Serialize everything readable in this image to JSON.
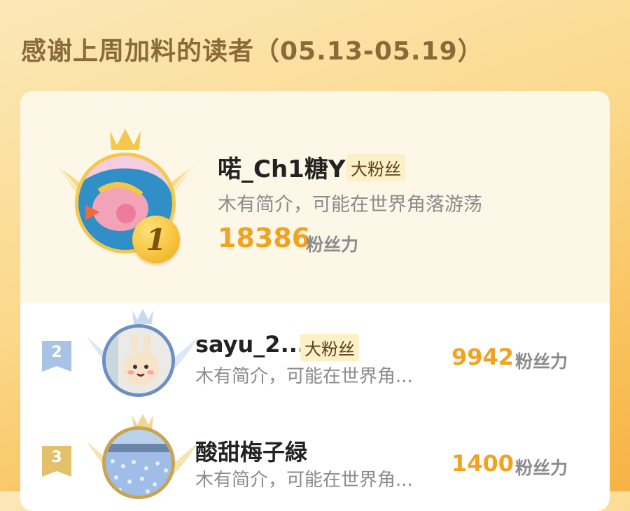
{
  "page": {
    "title": "感谢上周加料的读者（05.13-05.19）"
  },
  "colors": {
    "gold": "#f5c84a",
    "score": "#f0a321",
    "silver": "#a9c3e6",
    "bronze": "#e3c06a"
  },
  "ranking": [
    {
      "rank": "1",
      "name": "喏_Ch1糖Y",
      "tag": "大粉丝",
      "bio": "木有简介，可能在世界角落游荡",
      "score": "18386",
      "unit": "粉丝力"
    },
    {
      "rank": "2",
      "name": "sayu_2...",
      "tag": "大粉丝",
      "bio": "木有简介，可能在世界角...",
      "score": "9942",
      "unit": "粉丝力"
    },
    {
      "rank": "3",
      "name": "酸甜梅子緑",
      "tag": "",
      "bio": "木有简介，可能在世界角...",
      "score": "1400",
      "unit": "粉丝力"
    }
  ]
}
